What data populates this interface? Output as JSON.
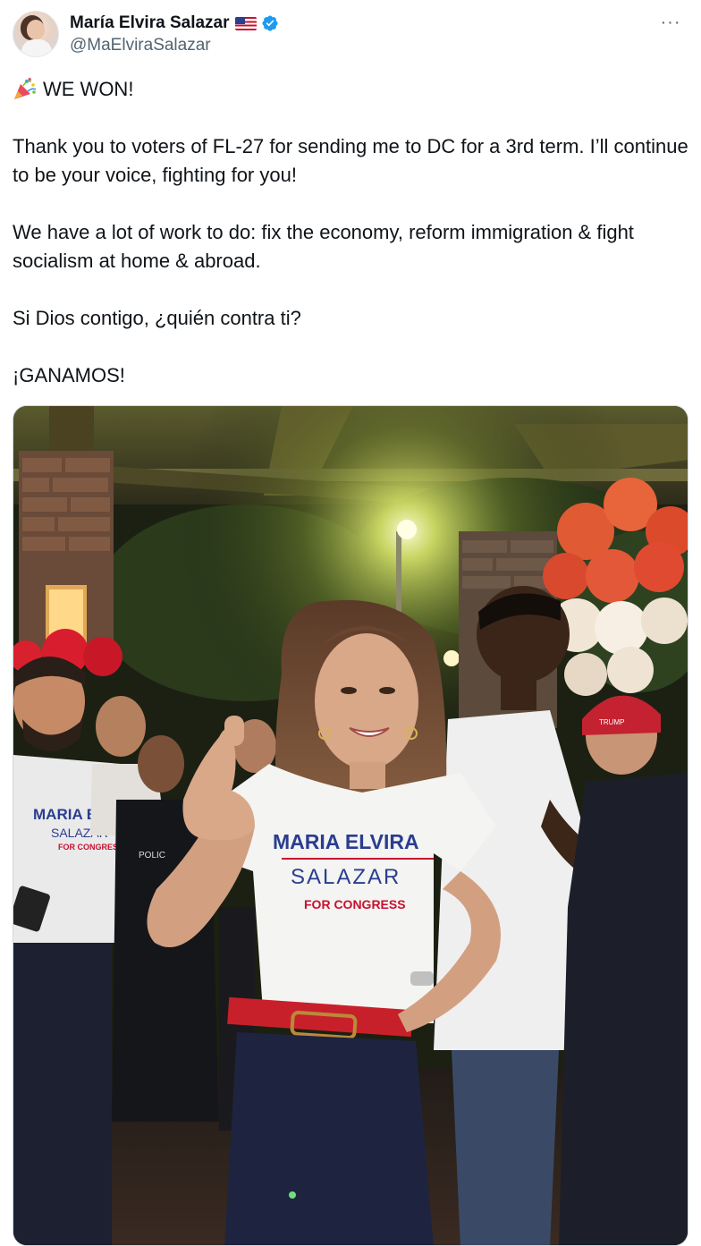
{
  "author": {
    "display_name": "María Elvira Salazar",
    "handle": "@MaElviraSalazar",
    "flag_icon": "us-flag-icon",
    "verified_icon": "verified-badge-icon",
    "verified_color": "#1d9bf0"
  },
  "menu": {
    "more_label": "···"
  },
  "tweet": {
    "line_1": "WE WON!",
    "paragraph_1": "Thank you to voters of FL-27 for sending me to DC for a 3rd term. I’ll continue to be your voice, fighting for you!",
    "paragraph_2": "We have a lot of work to do: fix the economy, reform immigration & fight socialism at home & abroad.",
    "paragraph_3": "Si Dios contigo, ¿quién contra ti?",
    "paragraph_4": "¡GANAMOS!"
  },
  "media": {
    "shirt_line_1": "MARIA ELVIRA",
    "shirt_line_2": "SALAZAR",
    "shirt_line_3": "FOR CONGRESS",
    "left_shirt_line_1": "MARIA ELVIRA",
    "left_shirt_line_2": "SALAZAR",
    "left_shirt_line_3": "FOR CONGRESS",
    "hat_text": "TRUMP",
    "police_text": "POLIC"
  },
  "colors": {
    "text_primary": "#0f1419",
    "text_secondary": "#536471",
    "shirt_blue": "#2a3d8f",
    "shirt_red": "#c8102e"
  }
}
